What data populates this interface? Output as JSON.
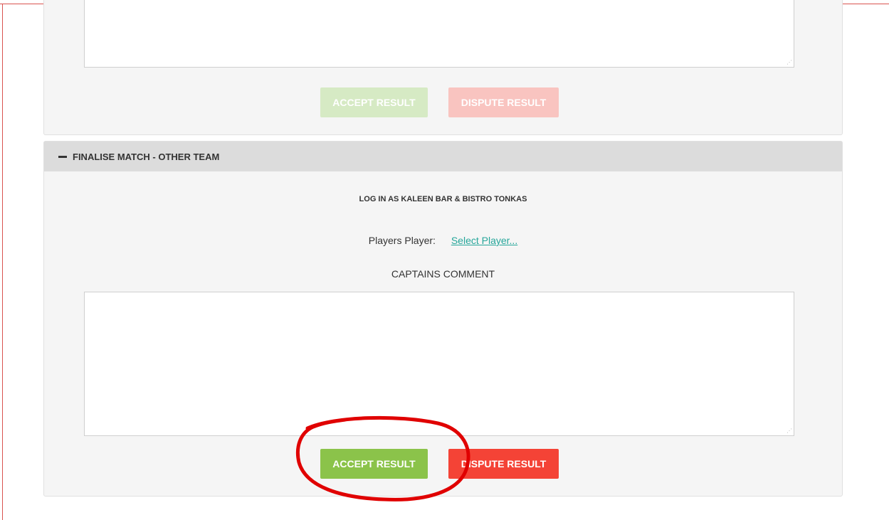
{
  "top_section": {
    "accept_label": "ACCEPT RESULT",
    "dispute_label": "DISPUTE RESULT"
  },
  "finalise_section": {
    "title": "FINALISE MATCH - OTHER TEAM",
    "login_text": "LOG IN AS KALEEN BAR & BISTRO TONKAS",
    "players_player_label": "Players Player:",
    "select_player_link": "Select Player...",
    "captains_comment_label": "CAPTAINS COMMENT",
    "comment_value": "",
    "accept_label": "ACCEPT RESULT",
    "dispute_label": "DISPUTE RESULT"
  },
  "colors": {
    "accept": "#8bc34a",
    "dispute": "#f44336",
    "link": "#26a69a",
    "annotation": "#e00000"
  },
  "icons": {
    "collapse": "minus-icon",
    "textarea_grip": "resize-grip-icon"
  }
}
